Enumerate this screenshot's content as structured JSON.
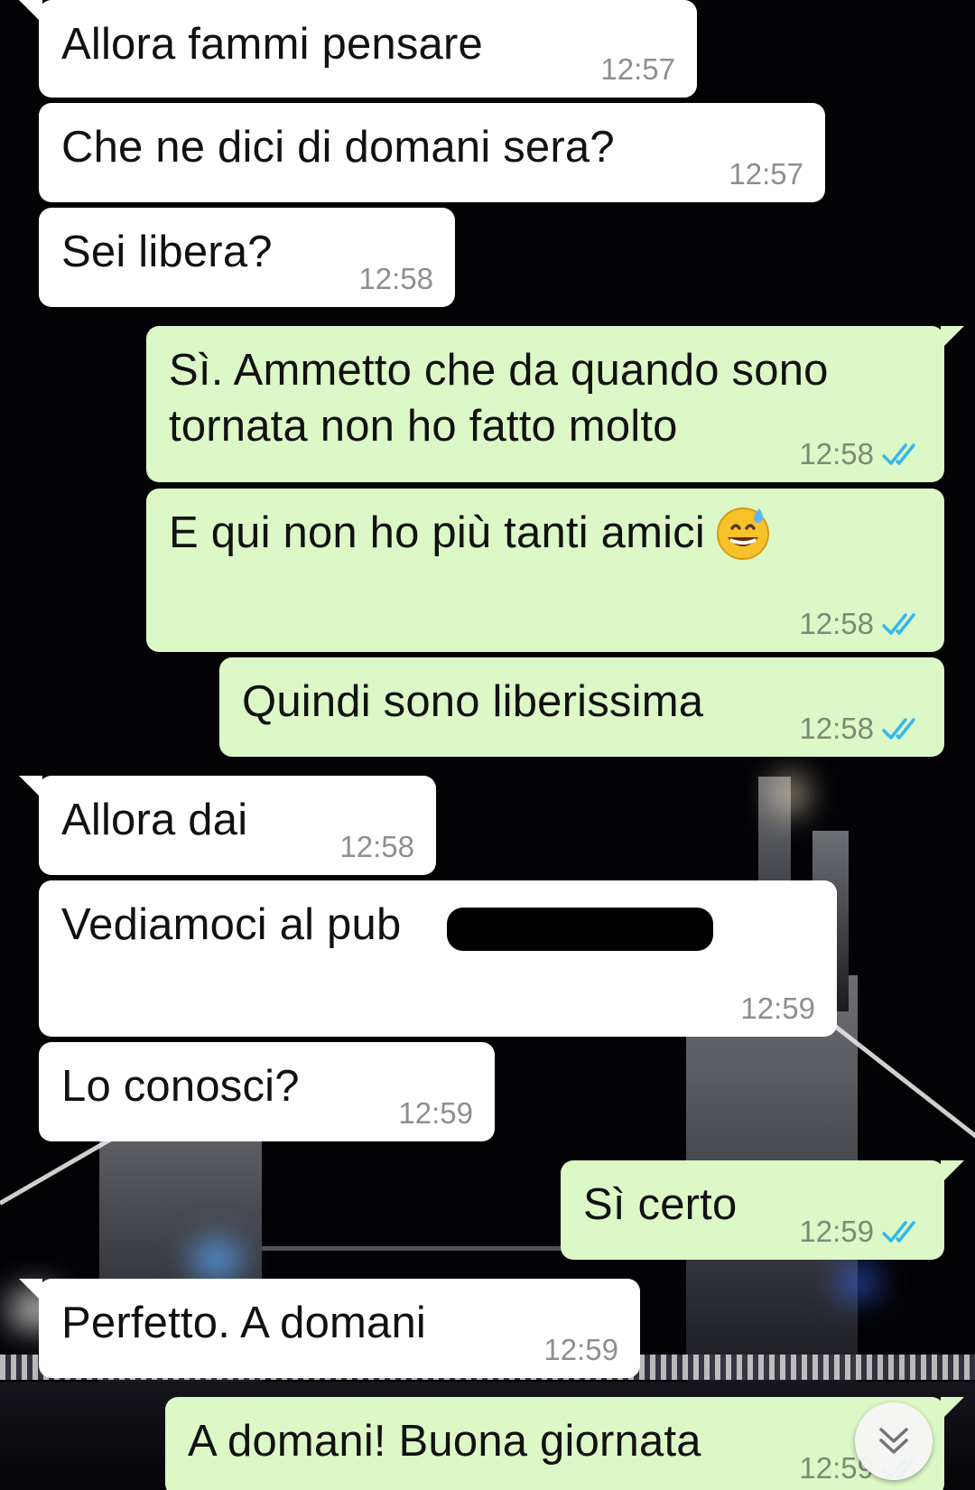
{
  "conversation": {
    "messages": [
      {
        "id": "m1",
        "direction": "incoming",
        "text": "Allora fammi pensare",
        "time": "12:57"
      },
      {
        "id": "m2",
        "direction": "incoming",
        "text": "Che ne dici di domani sera?",
        "time": "12:57"
      },
      {
        "id": "m3",
        "direction": "incoming",
        "text": "Sei libera?",
        "time": "12:58"
      },
      {
        "id": "m4",
        "direction": "outgoing",
        "text_line1": "Sì. Ammetto che da quando sono",
        "text_line2": "tornata non ho fatto molto",
        "time": "12:58",
        "status": "read"
      },
      {
        "id": "m5",
        "direction": "outgoing",
        "text": "E qui non ho più tanti amici",
        "emoji": "grinning-face-with-sweat",
        "time": "12:58",
        "status": "read"
      },
      {
        "id": "m6",
        "direction": "outgoing",
        "text": "Quindi sono liberissima",
        "time": "12:58",
        "status": "read"
      },
      {
        "id": "m7",
        "direction": "incoming",
        "text": "Allora dai",
        "time": "12:58"
      },
      {
        "id": "m8",
        "direction": "incoming",
        "text": "Vediamoci al pub",
        "redacted": true,
        "time": "12:59"
      },
      {
        "id": "m9",
        "direction": "incoming",
        "text": "Lo conosci?",
        "time": "12:59"
      },
      {
        "id": "m10",
        "direction": "outgoing",
        "text": "Sì certo",
        "time": "12:59",
        "status": "read"
      },
      {
        "id": "m11",
        "direction": "incoming",
        "text": "Perfetto. A domani",
        "time": "12:59"
      },
      {
        "id": "m12",
        "direction": "outgoing",
        "text": "A domani! Buona giornata",
        "time": "12:59",
        "status": "read"
      }
    ]
  },
  "icons": {
    "read_receipt": "double-check-icon",
    "scroll_down": "double-chevron-down-icon"
  },
  "colors": {
    "incoming_bubble": "#ffffff",
    "outgoing_bubble": "#dcf8c6",
    "read_check": "#34b7f1",
    "time_text": "#8c8f92"
  }
}
